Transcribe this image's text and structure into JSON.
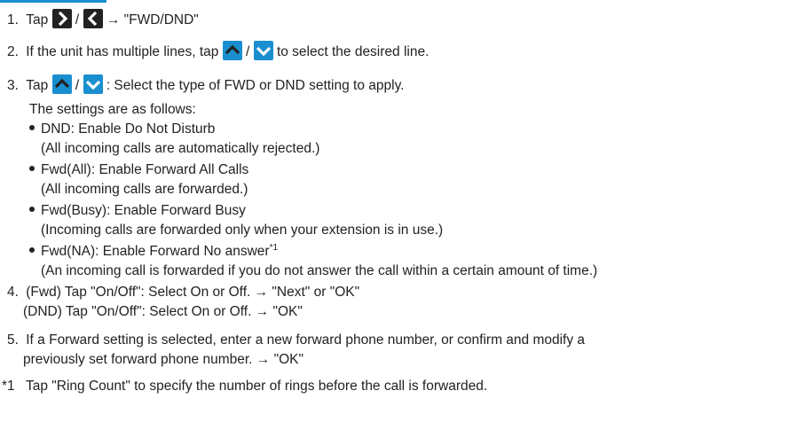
{
  "colors": {
    "icon_bg": "#1a8fd0",
    "icon_dark": "#222222",
    "text": "#222222"
  },
  "icons": {
    "next": "chevron-right-icon",
    "back": "chevron-left-icon",
    "up": "chevron-up-icon",
    "down": "chevron-down-icon"
  },
  "step1": {
    "num": "1.",
    "pre": "Tap",
    "slash": "/",
    "post": "→ \"FWD/DND\""
  },
  "step2": {
    "num": "2.",
    "pre": "If the unit has multiple lines, tap",
    "slash": "/",
    "post": "to select the desired line."
  },
  "step3": {
    "num": "3.",
    "pre": "Tap",
    "slash": "/",
    "post": ": Select the type of FWD or DND setting to apply.",
    "intro": "The settings are as follows:"
  },
  "settings": [
    {
      "title": "DND: Enable Do Not Disturb",
      "desc": "(All incoming calls are automatically rejected.)"
    },
    {
      "title": "Fwd(All): Enable Forward All Calls",
      "desc": "(All incoming calls are forwarded.)"
    },
    {
      "title": "Fwd(Busy): Enable Forward Busy",
      "desc": "(Incoming calls are forwarded only when your extension is in use.)"
    },
    {
      "title": "Fwd(NA): Enable Forward No answer",
      "sup": "*1",
      "desc": "(An incoming call is forwarded if you do not answer the call within a certain amount of time.)"
    }
  ],
  "step4": {
    "num": "4.",
    "line1": "(Fwd) Tap \"On/Off\": Select On or Off. → \"Next\" or \"OK\"",
    "line2": "(DND) Tap \"On/Off\": Select On or Off. → \"OK\""
  },
  "step5": {
    "num": "5.",
    "line1": "If a Forward setting is selected, enter a new forward phone number, or confirm and modify a",
    "line2": "previously set forward phone number. → \"OK\""
  },
  "footnote": {
    "mark": "*1",
    "text": "Tap \"Ring Count\" to specify the number of rings before the call is forwarded."
  }
}
